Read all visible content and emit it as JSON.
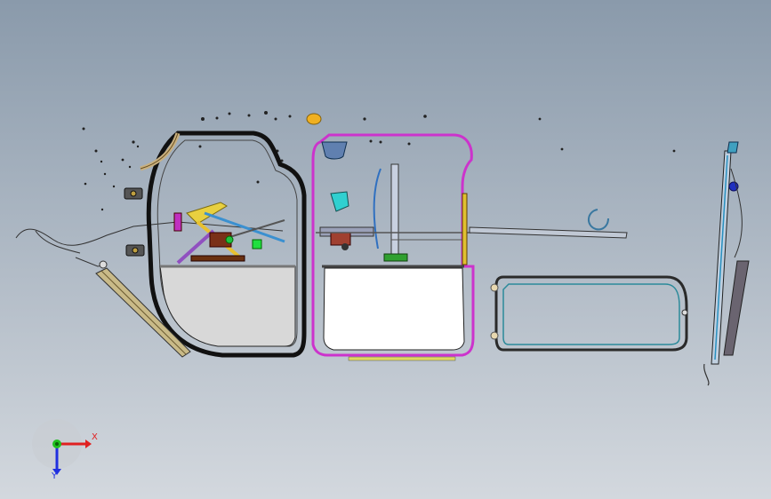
{
  "viewport": {
    "background_top": "#8a9aab",
    "background_bottom": "#d3d8de"
  },
  "triad": {
    "x_label": "X",
    "y_label": "Y",
    "x_color": "#e02020",
    "y_color": "#20c020",
    "z_color": "#2030e0"
  },
  "parts": {
    "door_frame_color": "#111111",
    "door_panel_color": "#d8d8d8",
    "highlight_frame_color": "#cc33cc",
    "glass_frame_color": "#2a2a2a",
    "regulator_color": "#e0c030",
    "rail_color": "#8090a0"
  }
}
